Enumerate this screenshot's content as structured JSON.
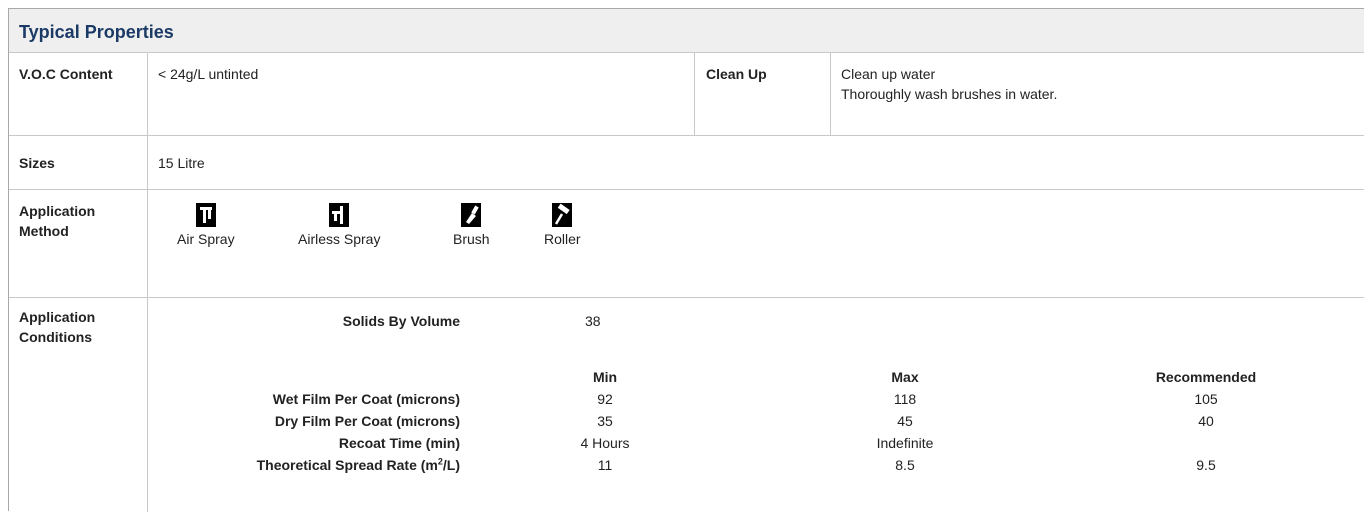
{
  "section_title": "Typical Properties",
  "voc": {
    "label": "V.O.C Content",
    "value": "< 24g/L untinted"
  },
  "clean_up": {
    "label": "Clean Up",
    "line1": "Clean up water",
    "line2": "Thoroughly wash brushes in water."
  },
  "sizes": {
    "label": "Sizes",
    "value": "15 Litre"
  },
  "application_method": {
    "label": "Application Method",
    "methods": [
      {
        "name": "Air Spray",
        "icon": "air-spray-icon"
      },
      {
        "name": "Airless Spray",
        "icon": "airless-spray-icon"
      },
      {
        "name": "Brush",
        "icon": "brush-icon"
      },
      {
        "name": "Roller",
        "icon": "roller-icon"
      }
    ]
  },
  "application_conditions": {
    "label": "Application Conditions",
    "solids_label": "Solids By Volume",
    "solids_value": "38",
    "headers": {
      "min": "Min",
      "max": "Max",
      "recommended": "Recommended"
    },
    "rows": [
      {
        "label": "Wet Film Per Coat (microns)",
        "min": "92",
        "max": "118",
        "recommended": "105"
      },
      {
        "label": "Dry Film Per Coat (microns)",
        "min": "35",
        "max": "45",
        "recommended": "40"
      },
      {
        "label": "Recoat Time (min)",
        "min": "4 Hours",
        "max": "Indefinite",
        "recommended": ""
      },
      {
        "label_pre": "Theoretical Spread Rate (m",
        "label_sup": "2",
        "label_post": "/L)",
        "min": "11",
        "max": "8.5",
        "recommended": "9.5"
      }
    ]
  },
  "colors": {
    "title": "#1b3a66",
    "header_bg": "#efefef",
    "border": "#c8c8c8"
  }
}
